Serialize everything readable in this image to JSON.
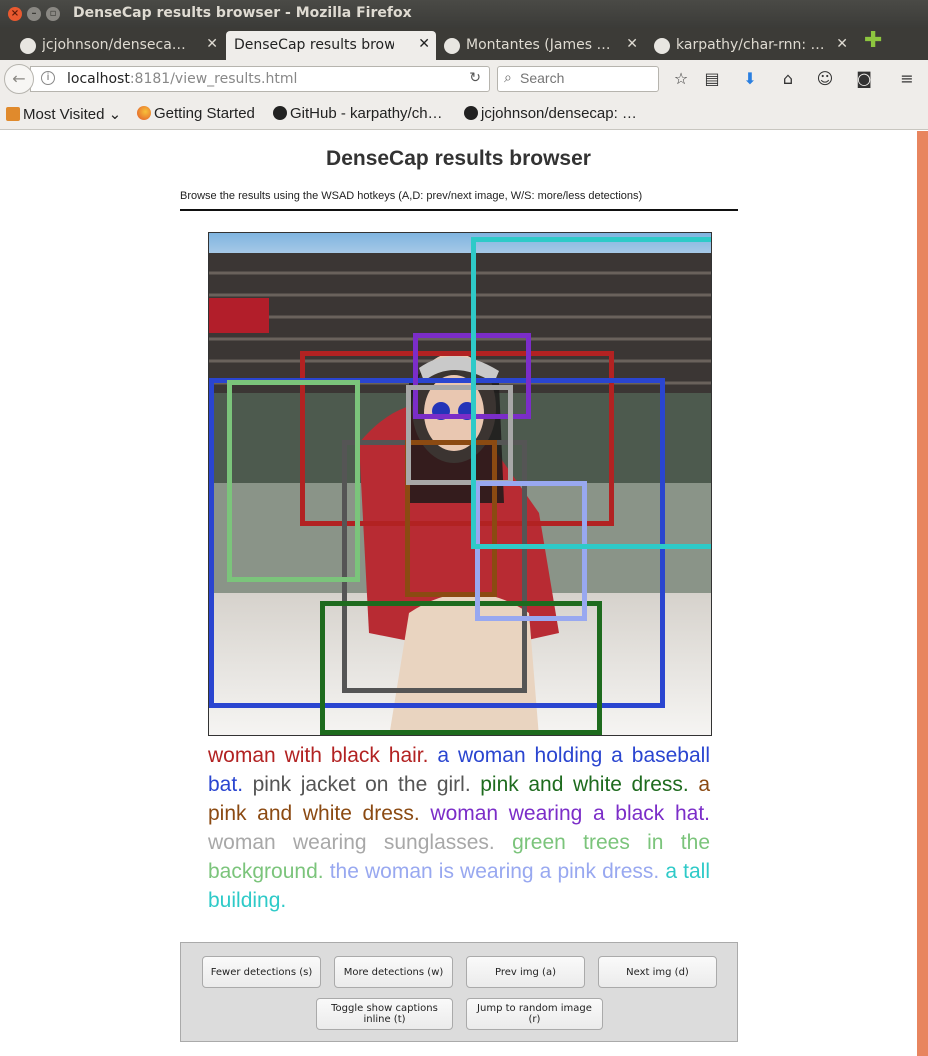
{
  "window": {
    "title": "DenseCap results browser - Mozilla Firefox"
  },
  "tabs": [
    {
      "label": "jcjohnson/denseca…",
      "active": false
    },
    {
      "label": "DenseCap results brow…",
      "active": true
    },
    {
      "label": "Montantes (James …",
      "active": false
    },
    {
      "label": "karpathy/char-rnn: …",
      "active": false
    }
  ],
  "nav": {
    "url_host": "localhost",
    "url_rest": ":8181/view_results.html",
    "search_placeholder": "Search"
  },
  "bookmarks": [
    {
      "label": "Most Visited",
      "icon": "folder-icon"
    },
    {
      "label": "Getting Started",
      "icon": "firefox-icon"
    },
    {
      "label": "GitHub - karpathy/ch…",
      "icon": "github-icon"
    },
    {
      "label": "jcjohnson/densecap: …",
      "icon": "github-icon"
    }
  ],
  "page": {
    "title": "DenseCap results browser",
    "subtitle": "Browse the results using the WSAD hotkeys (A,D: prev/next image, W/S: more/less detections)"
  },
  "detections": [
    {
      "caption": "woman with black hair.",
      "color": "#b22222"
    },
    {
      "caption": "a woman holding a baseball bat.",
      "color": "#2a45d0"
    },
    {
      "caption": "pink jacket on the girl.",
      "color": "#555555"
    },
    {
      "caption": "pink and white dress.",
      "color": "#1e6b1e"
    },
    {
      "caption": "a pink and white dress.",
      "color": "#8b4a12"
    },
    {
      "caption": "woman wearing a black hat.",
      "color": "#7b2dc8"
    },
    {
      "caption": "woman wearing sunglasses.",
      "color": "#a8a8a8"
    },
    {
      "caption": "green trees in the background.",
      "color": "#7bc47b"
    },
    {
      "caption": "the woman is wearing a pink dress.",
      "color": "#98a8f0"
    },
    {
      "caption": "a tall building.",
      "color": "#2ecac8"
    }
  ],
  "controls": {
    "fewer": "Fewer detections (s)",
    "more": "More detections (w)",
    "prev": "Prev img (a)",
    "next": "Next img (d)",
    "toggle": "Toggle show captions inline (t)",
    "random": "Jump to random image (r)"
  }
}
